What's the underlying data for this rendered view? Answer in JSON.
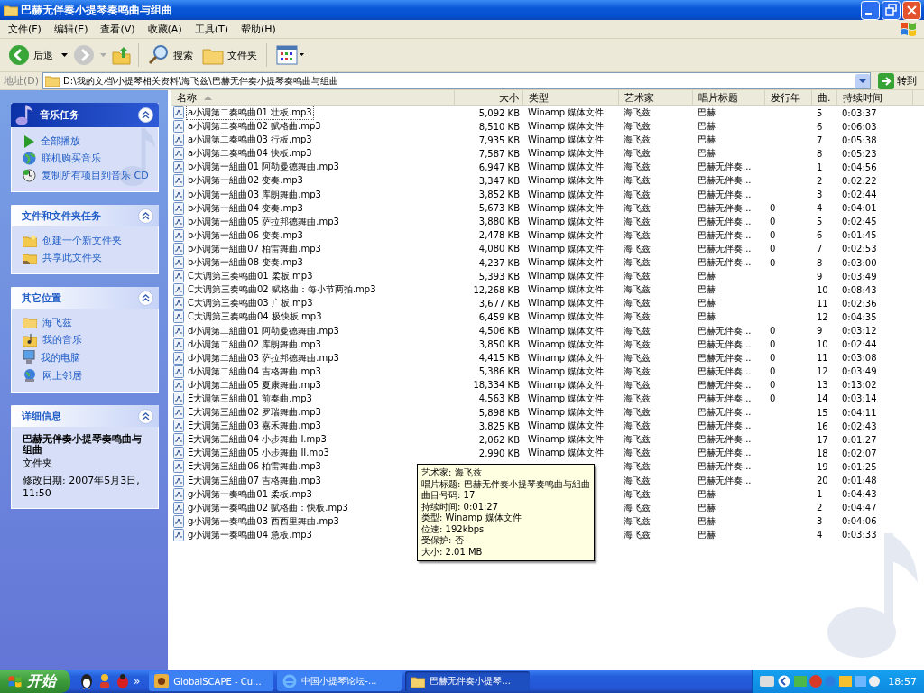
{
  "window": {
    "title": "巴赫无伴奏小提琴奏鸣曲与组曲"
  },
  "menu": [
    "文件(F)",
    "编辑(E)",
    "查看(V)",
    "收藏(A)",
    "工具(T)",
    "帮助(H)"
  ],
  "toolbar": {
    "back": "后退",
    "search": "搜索",
    "folders": "文件夹"
  },
  "address": {
    "label": "地址(D)",
    "value": "D:\\我的文档\\小提琴相关资料\\海飞兹\\巴赫无伴奏小提琴奏鸣曲与组曲",
    "go": "转到"
  },
  "sidebar": [
    {
      "title": "音乐任务",
      "special": true,
      "items": [
        {
          "label": "全部播放",
          "kind": "play"
        },
        {
          "label": "联机购买音乐",
          "kind": "globe"
        },
        {
          "label": "复制所有项目到音乐 CD",
          "kind": "cd"
        }
      ]
    },
    {
      "title": "文件和文件夹任务",
      "special": false,
      "items": [
        {
          "label": "创建一个新文件夹",
          "kind": "newfolder"
        },
        {
          "label": "共享此文件夹",
          "kind": "share"
        }
      ]
    },
    {
      "title": "其它位置",
      "special": false,
      "items": [
        {
          "label": "海飞兹",
          "kind": "folder"
        },
        {
          "label": "我的音乐",
          "kind": "music"
        },
        {
          "label": "我的电脑",
          "kind": "computer"
        },
        {
          "label": "网上邻居",
          "kind": "network"
        }
      ]
    }
  ],
  "details": {
    "title": "详细信息",
    "name": "巴赫无伴奏小提琴奏鸣曲与组曲",
    "type": "文件夹",
    "modified": "修改日期: 2007年5月3日, 11:50"
  },
  "columns": [
    {
      "label": "名称",
      "sorted": true
    },
    {
      "label": "大小",
      "sorted": false
    },
    {
      "label": "类型",
      "sorted": false
    },
    {
      "label": "艺术家",
      "sorted": false
    },
    {
      "label": "唱片标题",
      "sorted": false
    },
    {
      "label": "发行年",
      "sorted": false
    },
    {
      "label": "曲.",
      "sorted": false
    },
    {
      "label": "持续时间",
      "sorted": false
    }
  ],
  "rows": [
    {
      "name": "a小调第二奏鸣曲01 壮板.mp3",
      "size": "5,092 KB",
      "type": "Winamp 媒体文件",
      "artist": "海飞兹",
      "album": "巴赫",
      "track": "5",
      "duration": "0:03:37",
      "focused": true
    },
    {
      "name": "a小调第二奏鸣曲02 赋格曲.mp3",
      "size": "8,510 KB",
      "type": "Winamp 媒体文件",
      "artist": "海飞兹",
      "album": "巴赫",
      "track": "6",
      "duration": "0:06:03",
      "focused": false
    },
    {
      "name": "a小调第二奏鸣曲03 行板.mp3",
      "size": "7,935 KB",
      "type": "Winamp 媒体文件",
      "artist": "海飞兹",
      "album": "巴赫",
      "track": "7",
      "duration": "0:05:38",
      "focused": false
    },
    {
      "name": "a小调第二奏鸣曲04 快板.mp3",
      "size": "7,587 KB",
      "type": "Winamp 媒体文件",
      "artist": "海飞兹",
      "album": "巴赫",
      "track": "8",
      "duration": "0:05:23",
      "focused": false
    },
    {
      "name": "b小调第一組曲01 阿勒曼德舞曲.mp3",
      "size": "6,947 KB",
      "type": "Winamp 媒体文件",
      "artist": "海飞兹",
      "album": "巴赫无伴奏...",
      "track": "1",
      "duration": "0:04:56",
      "focused": false
    },
    {
      "name": "b小调第一組曲02 变奏.mp3",
      "size": "3,347 KB",
      "type": "Winamp 媒体文件",
      "artist": "海飞兹",
      "album": "巴赫无伴奏...",
      "track": "2",
      "duration": "0:02:22",
      "focused": false
    },
    {
      "name": "b小调第一組曲03 库朗舞曲.mp3",
      "size": "3,852 KB",
      "type": "Winamp 媒体文件",
      "artist": "海飞兹",
      "album": "巴赫无伴奏...",
      "track": "3",
      "duration": "0:02:44",
      "focused": false
    },
    {
      "name": "b小调第一組曲04 变奏.mp3",
      "size": "5,673 KB",
      "type": "Winamp 媒体文件",
      "artist": "海飞兹",
      "album": "巴赫无伴奏...",
      "year": "0",
      "track": "4",
      "duration": "0:04:01",
      "focused": false
    },
    {
      "name": "b小调第一組曲05 萨拉邦德舞曲.mp3",
      "size": "3,880 KB",
      "type": "Winamp 媒体文件",
      "artist": "海飞兹",
      "album": "巴赫无伴奏...",
      "year": "0",
      "track": "5",
      "duration": "0:02:45",
      "focused": false
    },
    {
      "name": "b小调第一組曲06 变奏.mp3",
      "size": "2,478 KB",
      "type": "Winamp 媒体文件",
      "artist": "海飞兹",
      "album": "巴赫无伴奏...",
      "year": "0",
      "track": "6",
      "duration": "0:01:45",
      "focused": false
    },
    {
      "name": "b小调第一組曲07 柏雷舞曲.mp3",
      "size": "4,080 KB",
      "type": "Winamp 媒体文件",
      "artist": "海飞兹",
      "album": "巴赫无伴奏...",
      "year": "0",
      "track": "7",
      "duration": "0:02:53",
      "focused": false
    },
    {
      "name": "b小调第一組曲08 变奏.mp3",
      "size": "4,237 KB",
      "type": "Winamp 媒体文件",
      "artist": "海飞兹",
      "album": "巴赫无伴奏...",
      "year": "0",
      "track": "8",
      "duration": "0:03:00",
      "focused": false
    },
    {
      "name": "C大调第三奏鸣曲01 柔板.mp3",
      "size": "5,393 KB",
      "type": "Winamp 媒体文件",
      "artist": "海飞兹",
      "album": "巴赫",
      "track": "9",
      "duration": "0:03:49",
      "focused": false
    },
    {
      "name": "C大调第三奏鸣曲02 赋格曲：每小节两拍.mp3",
      "size": "12,268 KB",
      "type": "Winamp 媒体文件",
      "artist": "海飞兹",
      "album": "巴赫",
      "track": "10",
      "duration": "0:08:43",
      "focused": false
    },
    {
      "name": "C大调第三奏鸣曲03 广板.mp3",
      "size": "3,677 KB",
      "type": "Winamp 媒体文件",
      "artist": "海飞兹",
      "album": "巴赫",
      "track": "11",
      "duration": "0:02:36",
      "focused": false
    },
    {
      "name": "C大调第三奏鸣曲04 极快板.mp3",
      "size": "6,459 KB",
      "type": "Winamp 媒体文件",
      "artist": "海飞兹",
      "album": "巴赫",
      "track": "12",
      "duration": "0:04:35",
      "focused": false
    },
    {
      "name": "d小调第二組曲01 阿勒曼德舞曲.mp3",
      "size": "4,506 KB",
      "type": "Winamp 媒体文件",
      "artist": "海飞兹",
      "album": "巴赫无伴奏...",
      "year": "0",
      "track": "9",
      "duration": "0:03:12",
      "focused": false
    },
    {
      "name": "d小调第二組曲02 库朗舞曲.mp3",
      "size": "3,850 KB",
      "type": "Winamp 媒体文件",
      "artist": "海飞兹",
      "album": "巴赫无伴奏...",
      "year": "0",
      "track": "10",
      "duration": "0:02:44",
      "focused": false
    },
    {
      "name": "d小调第二組曲03 萨拉邦德舞曲.mp3",
      "size": "4,415 KB",
      "type": "Winamp 媒体文件",
      "artist": "海飞兹",
      "album": "巴赫无伴奏...",
      "year": "0",
      "track": "11",
      "duration": "0:03:08",
      "focused": false
    },
    {
      "name": "d小调第二組曲04 吉格舞曲.mp3",
      "size": "5,386 KB",
      "type": "Winamp 媒体文件",
      "artist": "海飞兹",
      "album": "巴赫无伴奏...",
      "year": "0",
      "track": "12",
      "duration": "0:03:49",
      "focused": false
    },
    {
      "name": "d小调第二組曲05 夏康舞曲.mp3",
      "size": "18,334 KB",
      "type": "Winamp 媒体文件",
      "artist": "海飞兹",
      "album": "巴赫无伴奏...",
      "year": "0",
      "track": "13",
      "duration": "0:13:02",
      "focused": false
    },
    {
      "name": "E大调第三組曲01 前奏曲.mp3",
      "size": "4,563 KB",
      "type": "Winamp 媒体文件",
      "artist": "海飞兹",
      "album": "巴赫无伴奏...",
      "year": "0",
      "track": "14",
      "duration": "0:03:14",
      "focused": false
    },
    {
      "name": "E大调第三組曲02 罗瑞舞曲.mp3",
      "size": "5,898 KB",
      "type": "Winamp 媒体文件",
      "artist": "海飞兹",
      "album": "巴赫无伴奏...",
      "track": "15",
      "duration": "0:04:11",
      "focused": false
    },
    {
      "name": "E大调第三組曲03 嘉禾舞曲.mp3",
      "size": "3,825 KB",
      "type": "Winamp 媒体文件",
      "artist": "海飞兹",
      "album": "巴赫无伴奏...",
      "track": "16",
      "duration": "0:02:43",
      "focused": false
    },
    {
      "name": "E大调第三組曲04 小步舞曲 I.mp3",
      "size": "2,062 KB",
      "type": "Winamp 媒体文件",
      "artist": "海飞兹",
      "album": "巴赫无伴奏...",
      "track": "17",
      "duration": "0:01:27",
      "focused": false
    },
    {
      "name": "E大调第三組曲05 小步舞曲 II.mp3",
      "size": "2,990 KB",
      "type": "Winamp 媒体文件",
      "artist": "海飞兹",
      "album": "巴赫无伴奏...",
      "track": "18",
      "duration": "0:02:07",
      "focused": false
    },
    {
      "name": "E大调第三組曲06 柏雷舞曲.mp3",
      "artist": "海飞兹",
      "album": "巴赫无伴奏...",
      "track": "19",
      "duration": "0:01:25",
      "focused": false
    },
    {
      "name": "E大调第三組曲07 吉格舞曲.mp3",
      "artist": "海飞兹",
      "album": "巴赫无伴奏...",
      "track": "20",
      "duration": "0:01:48",
      "focused": false
    },
    {
      "name": "g小调第一奏鸣曲01 柔板.mp3",
      "artist": "海飞兹",
      "album": "巴赫",
      "track": "1",
      "duration": "0:04:43",
      "focused": false
    },
    {
      "name": "g小调第一奏鸣曲02 赋格曲：快板.mp3",
      "artist": "海飞兹",
      "album": "巴赫",
      "track": "2",
      "duration": "0:04:47",
      "focused": false
    },
    {
      "name": "g小调第一奏鸣曲03 西西里舞曲.mp3",
      "artist": "海飞兹",
      "album": "巴赫",
      "track": "3",
      "duration": "0:04:06",
      "focused": false
    },
    {
      "name": "g小调第一奏鸣曲04 急板.mp3",
      "artist": "海飞兹",
      "album": "巴赫",
      "track": "4",
      "duration": "0:03:33",
      "focused": false
    }
  ],
  "tooltip": [
    "艺术家: 海飞兹",
    "唱片标题: 巴赫无伴奏小提琴奏鸣曲与組曲",
    "曲目号码: 17",
    "持续时间: 0:01:27",
    "类型: Winamp 媒体文件",
    "位速: 192kbps",
    "受保护: 否",
    "大小: 2.01 MB"
  ],
  "taskbar": {
    "start": "开始",
    "more": "»",
    "tasks": [
      {
        "label": "GlobalSCAPE - Cu...",
        "selected": false
      },
      {
        "label": "中国小提琴论坛-...",
        "selected": false
      },
      {
        "label": "巴赫无伴奏小提琴...",
        "selected": true
      }
    ],
    "clock": "18:57"
  }
}
